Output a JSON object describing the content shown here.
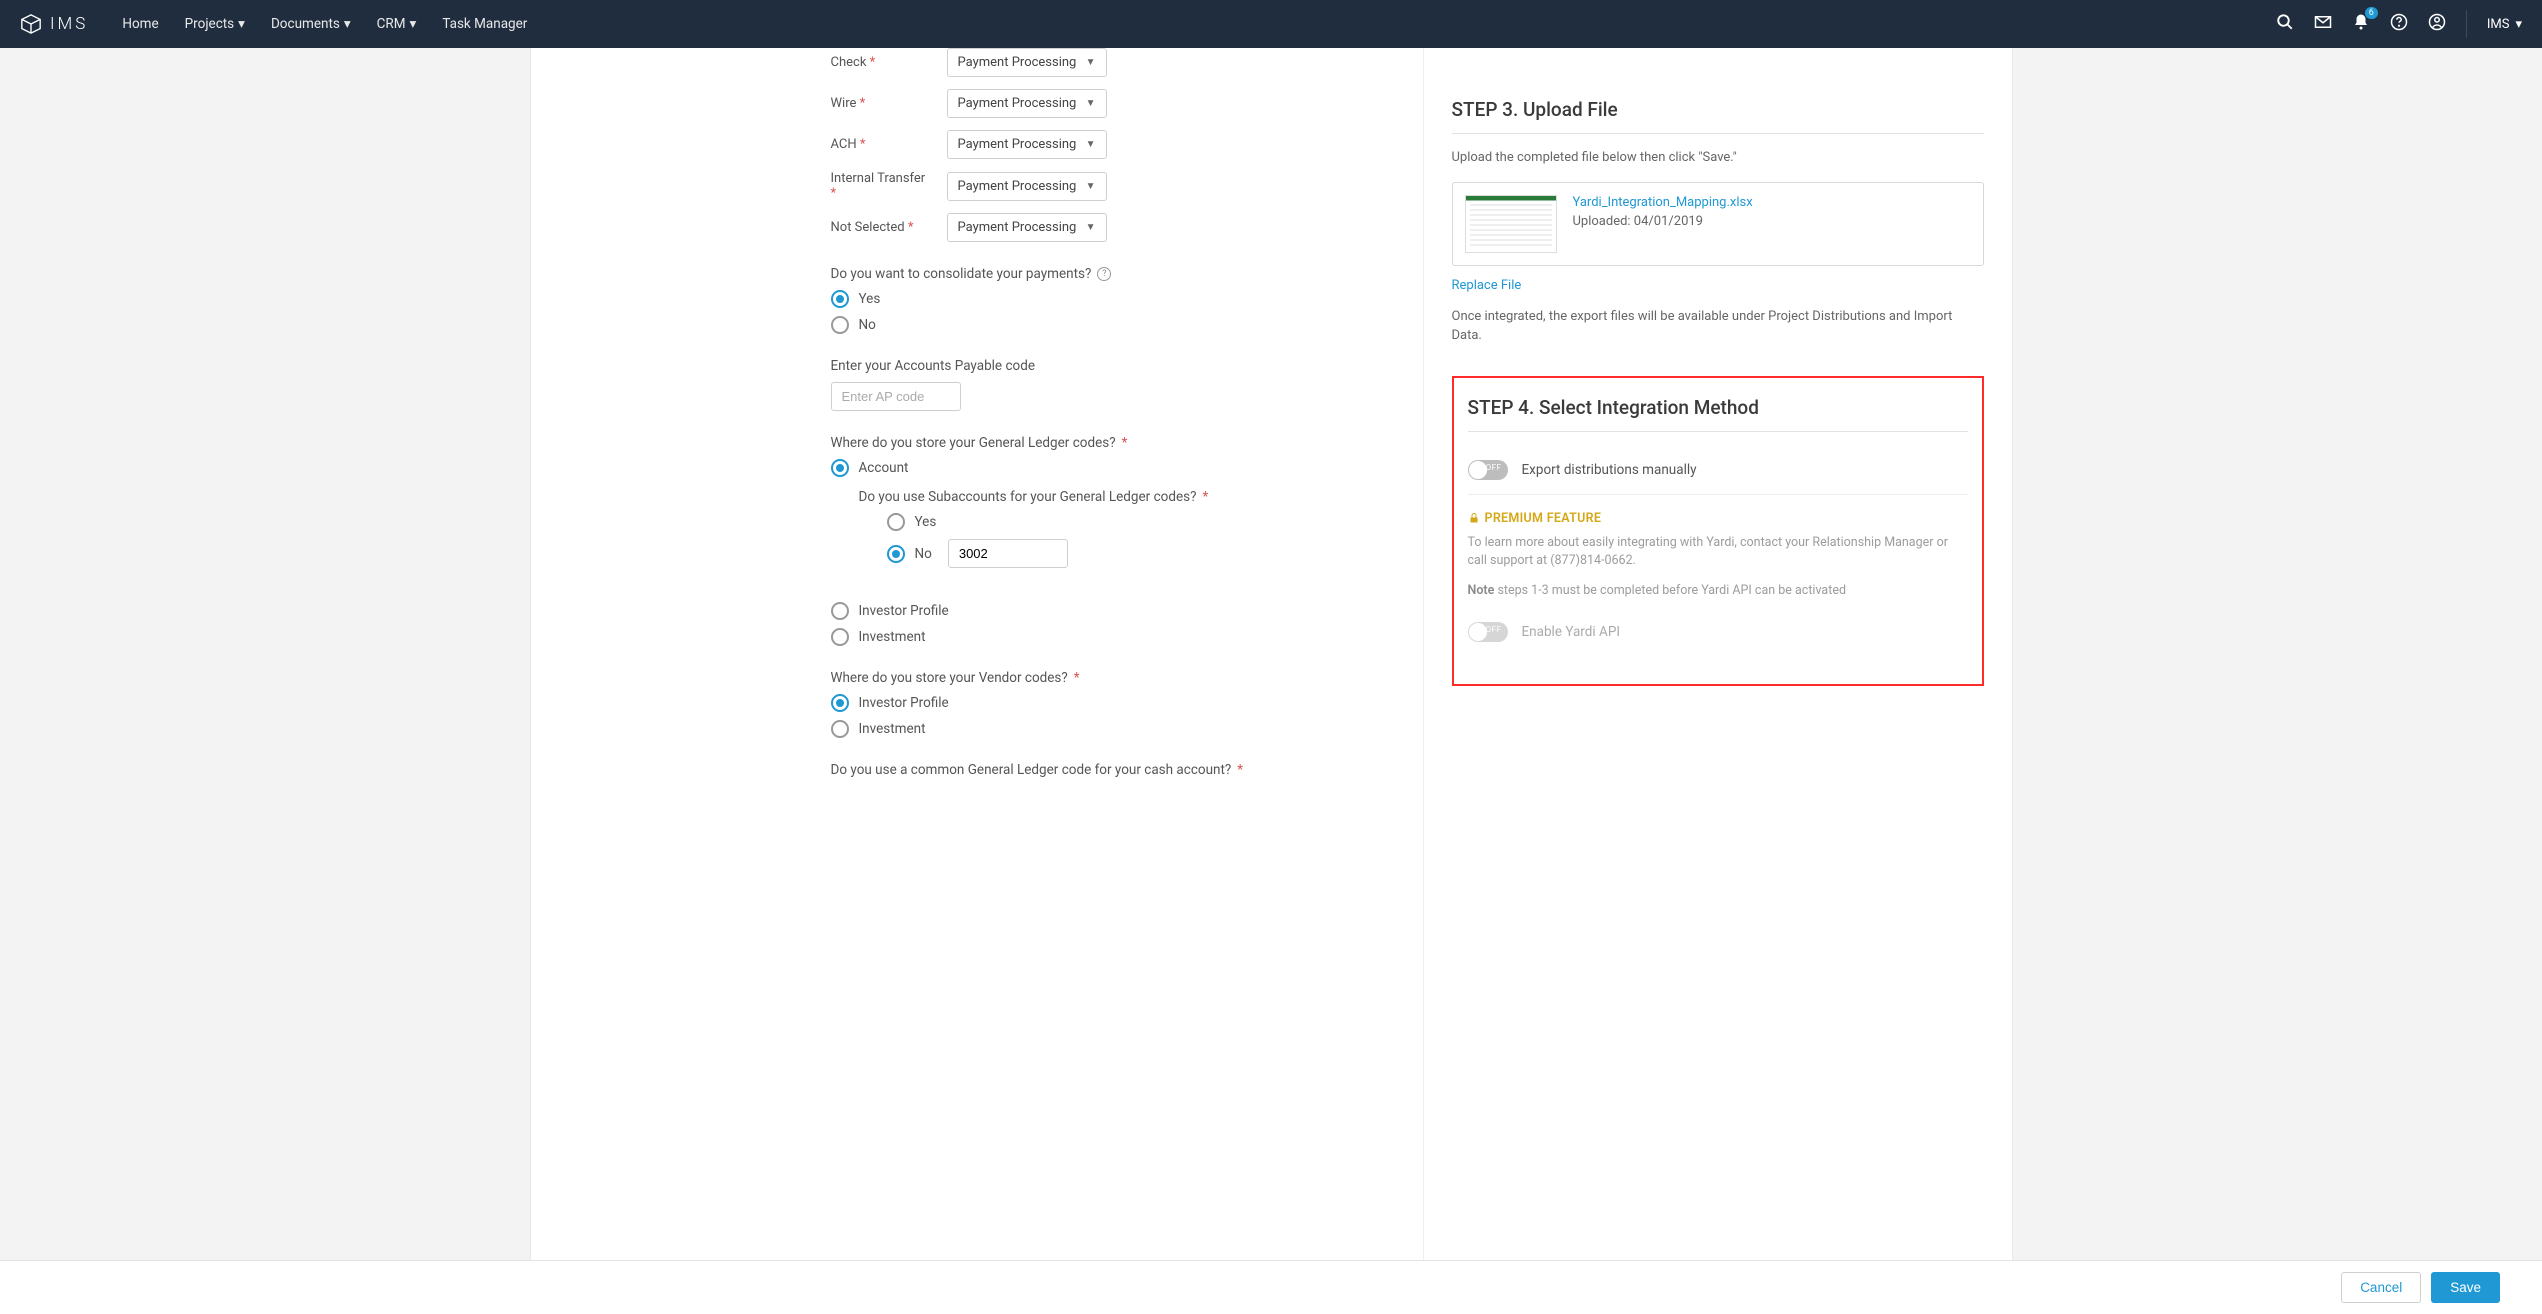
{
  "header": {
    "brand": "IMS",
    "nav": [
      "Home",
      "Projects",
      "Documents",
      "CRM",
      "Task Manager"
    ],
    "notification_count": "6",
    "user_label": "IMS"
  },
  "left": {
    "payment_methods": [
      {
        "label": "Check",
        "value": "Payment Processing"
      },
      {
        "label": "Wire",
        "value": "Payment Processing"
      },
      {
        "label": "ACH",
        "value": "Payment Processing"
      },
      {
        "label": "Internal Transfer",
        "value": "Payment Processing"
      },
      {
        "label": "Not Selected",
        "value": "Payment Processing"
      }
    ],
    "consolidate_q": "Do you want to consolidate your payments?",
    "consolidate_yes": "Yes",
    "consolidate_no": "No",
    "ap_label": "Enter your Accounts Payable code",
    "ap_placeholder": "Enter AP code",
    "gl_q": "Where do you store your General Ledger codes?",
    "gl_account": "Account",
    "gl_sub_q": "Do you use Subaccounts for your General Ledger codes?",
    "gl_sub_yes": "Yes",
    "gl_sub_no": "No",
    "gl_sub_no_value": "3002",
    "gl_investor_profile": "Investor Profile",
    "gl_investment": "Investment",
    "vendor_q": "Where do you store your Vendor codes?",
    "vendor_investor_profile": "Investor Profile",
    "vendor_investment": "Investment",
    "cash_q": "Do you use a common General Ledger code for your cash account?"
  },
  "right": {
    "step3": {
      "title": "STEP 3. Upload File",
      "instruction": "Upload the completed file below then click \"Save.\"",
      "filename": "Yardi_Integration_Mapping.xlsx",
      "uploaded": "Uploaded: 04/01/2019",
      "replace": "Replace File",
      "note": "Once integrated, the export files will be available under Project Distributions and Import Data."
    },
    "step4": {
      "title": "STEP 4. Select Integration Method",
      "toggle1_label": "Export distributions manually",
      "toggle1_state": "OFF",
      "premium_label": "PREMIUM FEATURE",
      "premium_desc": "To learn more about easily integrating with Yardi, contact your Relationship Manager or call support at (877)814-0662.",
      "note_prefix": "Note",
      "note_rest": " steps 1-3 must be completed before Yardi API can be activated",
      "toggle2_label": "Enable Yardi API",
      "toggle2_state": "OFF"
    }
  },
  "footer": {
    "cancel": "Cancel",
    "save": "Save"
  }
}
